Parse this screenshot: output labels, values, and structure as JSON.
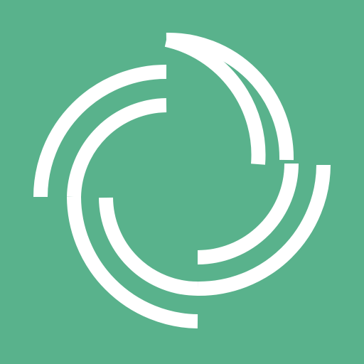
{
  "icon": {
    "name": "swirl-logo-icon",
    "background_color": "#59b28c",
    "stroke_color": "#ffffff"
  }
}
